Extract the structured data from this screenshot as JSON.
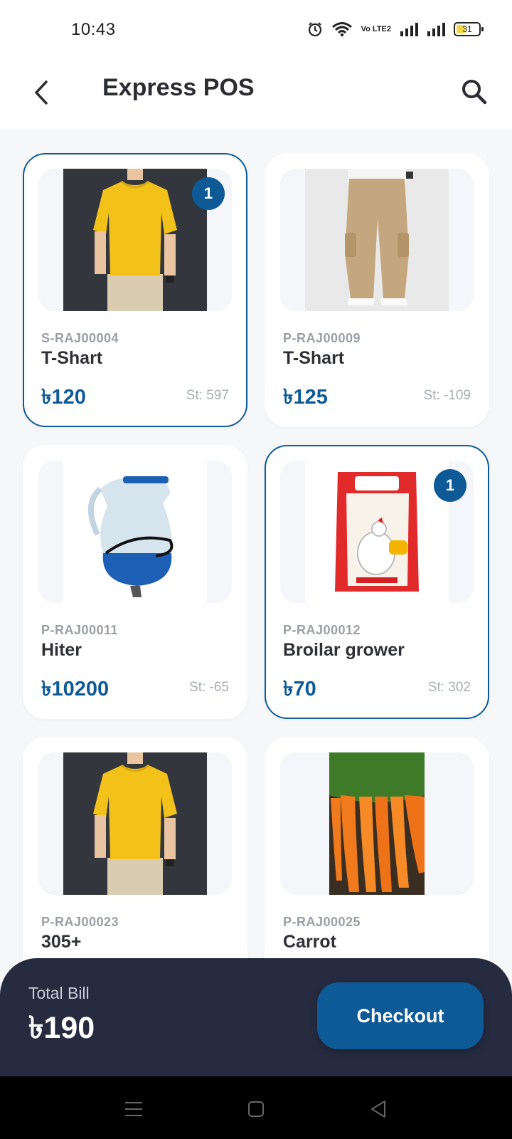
{
  "status_bar": {
    "time": "10:43",
    "volte_label": "Vo LTE2",
    "battery_level": "31"
  },
  "app_bar": {
    "title": "Express POS",
    "back_icon": "chevron-left-icon",
    "search_icon": "search-icon"
  },
  "currency_symbol": "৳",
  "products": [
    {
      "sku": "S-RAJ00004",
      "name": "T-Shart",
      "price": "৳120",
      "stock": "St: 597",
      "selected": true,
      "qty": "1",
      "image": "yellow-tshirt-image"
    },
    {
      "sku": "P-RAJ00009",
      "name": "T-Shart",
      "price": "৳125",
      "stock": "St: -109",
      "selected": false,
      "qty": "",
      "image": "khaki-cargo-pants-image"
    },
    {
      "sku": "P-RAJ00011",
      "name": "Hiter",
      "price": "৳10200",
      "stock": "St: -65",
      "selected": false,
      "qty": "",
      "image": "water-heater-jug-image"
    },
    {
      "sku": "P-RAJ00012",
      "name": "Broilar grower",
      "price": "৳70",
      "stock": "St: 302",
      "selected": true,
      "qty": "1",
      "image": "feed-bag-image"
    },
    {
      "sku": "P-RAJ00023",
      "name": "305+",
      "price": "",
      "stock": "",
      "selected": false,
      "qty": "",
      "image": "yellow-tshirt-image"
    },
    {
      "sku": "P-RAJ00025",
      "name": "Carrot",
      "price": "",
      "stock": "",
      "selected": false,
      "qty": "",
      "image": "carrots-image"
    }
  ],
  "bill": {
    "label": "Total Bill",
    "amount": "৳190",
    "checkout_label": "Checkout"
  },
  "nav": {
    "menu_icon": "menu-icon",
    "home_icon": "home-square-icon",
    "back_icon": "back-triangle-icon"
  },
  "colors": {
    "accent": "#0e5a96",
    "bill_bar": "#262b3f",
    "background": "#f6f7f9"
  }
}
